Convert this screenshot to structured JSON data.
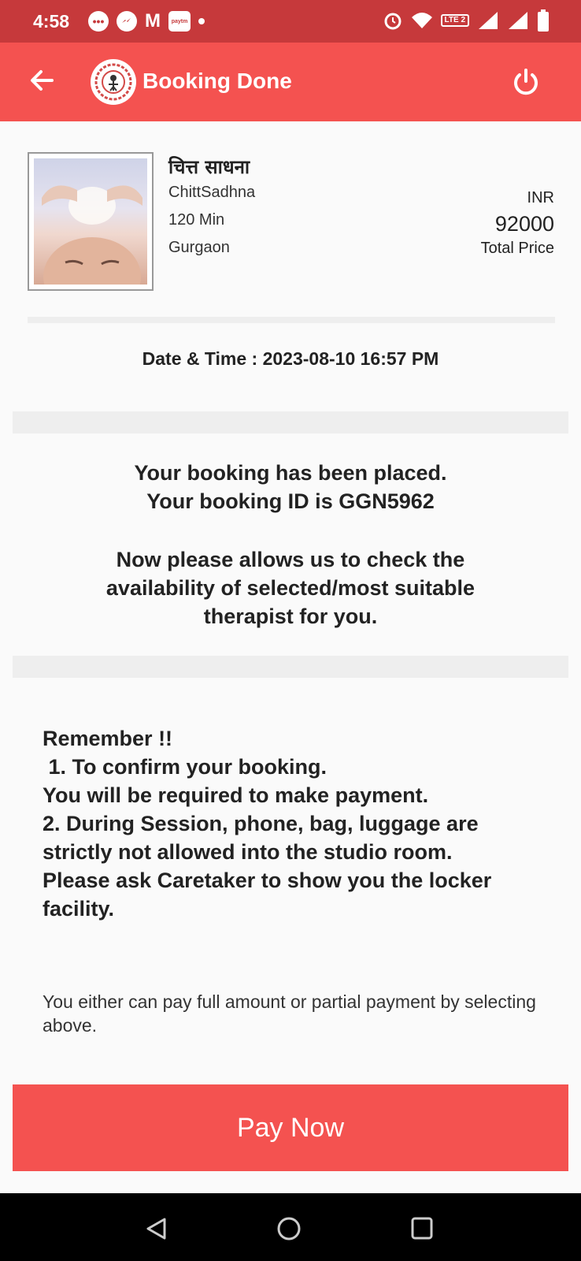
{
  "status_bar": {
    "time": "4:58",
    "lte_label": "LTE 2",
    "icons": [
      "chat-icon",
      "messenger-icon",
      "gmail-icon",
      "paytm-icon",
      "dot-icon",
      "alarm-icon",
      "wifi-icon",
      "signal-icon",
      "battery-icon"
    ]
  },
  "app_bar": {
    "title": "Booking Done",
    "back_icon": "arrow-left-icon",
    "logo": "app-logo",
    "power_icon": "power-icon"
  },
  "product": {
    "name_hindi": "चित्त साधना",
    "name": "ChittSadhna",
    "duration": "120 Min",
    "location": "Gurgaon",
    "currency": "INR",
    "price": "92000",
    "price_label": "Total Price"
  },
  "booking": {
    "datetime": "Date & Time : 2023-08-10 16:57 PM",
    "placed_line1": "Your booking has been placed.",
    "placed_line2": "Your booking ID is GGN5962",
    "check_line1": "Now please allows us to check the",
    "check_line2": "availability of selected/most suitable",
    "check_line3": "therapist for you."
  },
  "remember": {
    "l1": "Remember !!",
    "l2": " 1. To confirm your booking.",
    "l3": "You will be required to make payment.",
    "l4": "2. During Session, phone, bag, luggage are",
    "l5": "strictly not allowed into the studio room.",
    "l6": "Please ask Caretaker to show you the locker",
    "l7": "facility."
  },
  "note": "You either can pay full amount or partial payment by selecting above.",
  "pay_button": "Pay Now",
  "nav": [
    "back-triangle-icon",
    "home-circle-icon",
    "recents-square-icon"
  ]
}
